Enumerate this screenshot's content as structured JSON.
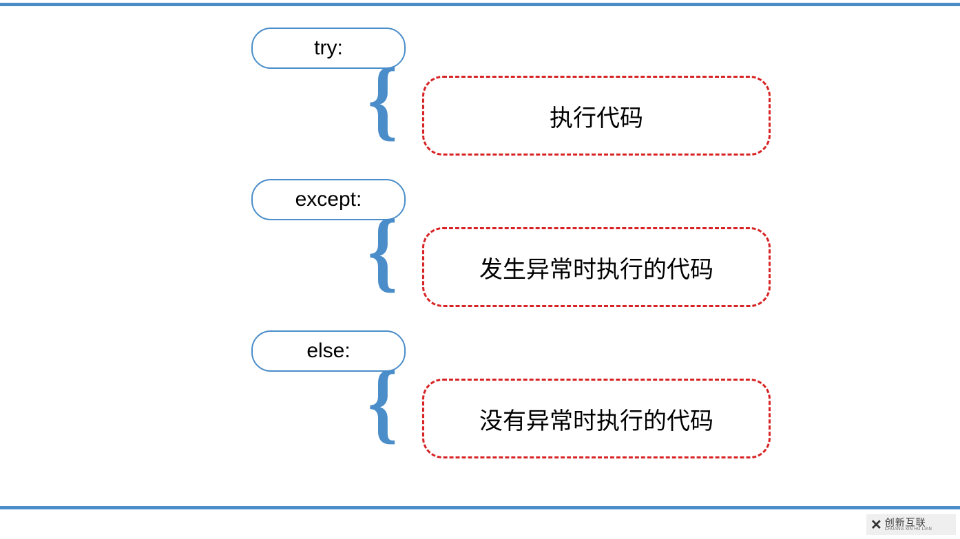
{
  "colors": {
    "blue": "#4a8dc9",
    "red": "#d72324"
  },
  "blocks": [
    {
      "keyword": "try:",
      "brace": "{",
      "desc": "执行代码"
    },
    {
      "keyword": "except:",
      "brace": "{",
      "desc": "发生异常时执行的代码"
    },
    {
      "keyword": "else:",
      "brace": "{",
      "desc": "没有异常时执行的代码"
    }
  ],
  "watermark": {
    "logo_glyph": "✕",
    "cn": "创新互联",
    "en": "CHUANG XIN HU LIAN"
  }
}
